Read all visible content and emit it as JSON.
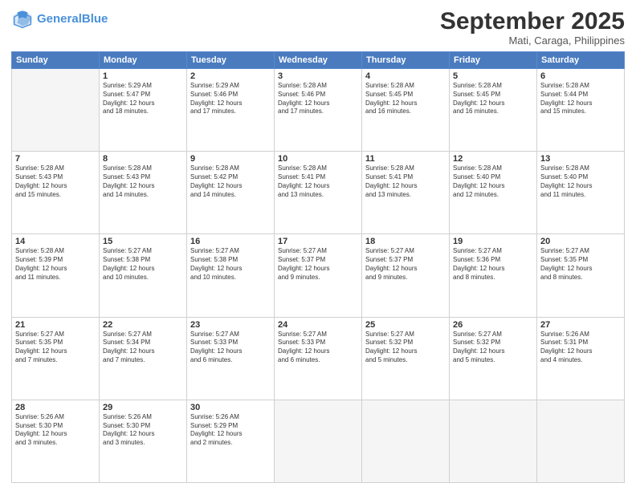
{
  "header": {
    "logo_line1": "General",
    "logo_line2": "Blue",
    "month": "September 2025",
    "location": "Mati, Caraga, Philippines"
  },
  "weekdays": [
    "Sunday",
    "Monday",
    "Tuesday",
    "Wednesday",
    "Thursday",
    "Friday",
    "Saturday"
  ],
  "weeks": [
    [
      {
        "day": "",
        "info": ""
      },
      {
        "day": "1",
        "info": "Sunrise: 5:29 AM\nSunset: 5:47 PM\nDaylight: 12 hours\nand 18 minutes."
      },
      {
        "day": "2",
        "info": "Sunrise: 5:29 AM\nSunset: 5:46 PM\nDaylight: 12 hours\nand 17 minutes."
      },
      {
        "day": "3",
        "info": "Sunrise: 5:28 AM\nSunset: 5:46 PM\nDaylight: 12 hours\nand 17 minutes."
      },
      {
        "day": "4",
        "info": "Sunrise: 5:28 AM\nSunset: 5:45 PM\nDaylight: 12 hours\nand 16 minutes."
      },
      {
        "day": "5",
        "info": "Sunrise: 5:28 AM\nSunset: 5:45 PM\nDaylight: 12 hours\nand 16 minutes."
      },
      {
        "day": "6",
        "info": "Sunrise: 5:28 AM\nSunset: 5:44 PM\nDaylight: 12 hours\nand 15 minutes."
      }
    ],
    [
      {
        "day": "7",
        "info": "Sunrise: 5:28 AM\nSunset: 5:43 PM\nDaylight: 12 hours\nand 15 minutes."
      },
      {
        "day": "8",
        "info": "Sunrise: 5:28 AM\nSunset: 5:43 PM\nDaylight: 12 hours\nand 14 minutes."
      },
      {
        "day": "9",
        "info": "Sunrise: 5:28 AM\nSunset: 5:42 PM\nDaylight: 12 hours\nand 14 minutes."
      },
      {
        "day": "10",
        "info": "Sunrise: 5:28 AM\nSunset: 5:41 PM\nDaylight: 12 hours\nand 13 minutes."
      },
      {
        "day": "11",
        "info": "Sunrise: 5:28 AM\nSunset: 5:41 PM\nDaylight: 12 hours\nand 13 minutes."
      },
      {
        "day": "12",
        "info": "Sunrise: 5:28 AM\nSunset: 5:40 PM\nDaylight: 12 hours\nand 12 minutes."
      },
      {
        "day": "13",
        "info": "Sunrise: 5:28 AM\nSunset: 5:40 PM\nDaylight: 12 hours\nand 11 minutes."
      }
    ],
    [
      {
        "day": "14",
        "info": "Sunrise: 5:28 AM\nSunset: 5:39 PM\nDaylight: 12 hours\nand 11 minutes."
      },
      {
        "day": "15",
        "info": "Sunrise: 5:27 AM\nSunset: 5:38 PM\nDaylight: 12 hours\nand 10 minutes."
      },
      {
        "day": "16",
        "info": "Sunrise: 5:27 AM\nSunset: 5:38 PM\nDaylight: 12 hours\nand 10 minutes."
      },
      {
        "day": "17",
        "info": "Sunrise: 5:27 AM\nSunset: 5:37 PM\nDaylight: 12 hours\nand 9 minutes."
      },
      {
        "day": "18",
        "info": "Sunrise: 5:27 AM\nSunset: 5:37 PM\nDaylight: 12 hours\nand 9 minutes."
      },
      {
        "day": "19",
        "info": "Sunrise: 5:27 AM\nSunset: 5:36 PM\nDaylight: 12 hours\nand 8 minutes."
      },
      {
        "day": "20",
        "info": "Sunrise: 5:27 AM\nSunset: 5:35 PM\nDaylight: 12 hours\nand 8 minutes."
      }
    ],
    [
      {
        "day": "21",
        "info": "Sunrise: 5:27 AM\nSunset: 5:35 PM\nDaylight: 12 hours\nand 7 minutes."
      },
      {
        "day": "22",
        "info": "Sunrise: 5:27 AM\nSunset: 5:34 PM\nDaylight: 12 hours\nand 7 minutes."
      },
      {
        "day": "23",
        "info": "Sunrise: 5:27 AM\nSunset: 5:33 PM\nDaylight: 12 hours\nand 6 minutes."
      },
      {
        "day": "24",
        "info": "Sunrise: 5:27 AM\nSunset: 5:33 PM\nDaylight: 12 hours\nand 6 minutes."
      },
      {
        "day": "25",
        "info": "Sunrise: 5:27 AM\nSunset: 5:32 PM\nDaylight: 12 hours\nand 5 minutes."
      },
      {
        "day": "26",
        "info": "Sunrise: 5:27 AM\nSunset: 5:32 PM\nDaylight: 12 hours\nand 5 minutes."
      },
      {
        "day": "27",
        "info": "Sunrise: 5:26 AM\nSunset: 5:31 PM\nDaylight: 12 hours\nand 4 minutes."
      }
    ],
    [
      {
        "day": "28",
        "info": "Sunrise: 5:26 AM\nSunset: 5:30 PM\nDaylight: 12 hours\nand 3 minutes."
      },
      {
        "day": "29",
        "info": "Sunrise: 5:26 AM\nSunset: 5:30 PM\nDaylight: 12 hours\nand 3 minutes."
      },
      {
        "day": "30",
        "info": "Sunrise: 5:26 AM\nSunset: 5:29 PM\nDaylight: 12 hours\nand 2 minutes."
      },
      {
        "day": "",
        "info": ""
      },
      {
        "day": "",
        "info": ""
      },
      {
        "day": "",
        "info": ""
      },
      {
        "day": "",
        "info": ""
      }
    ]
  ]
}
